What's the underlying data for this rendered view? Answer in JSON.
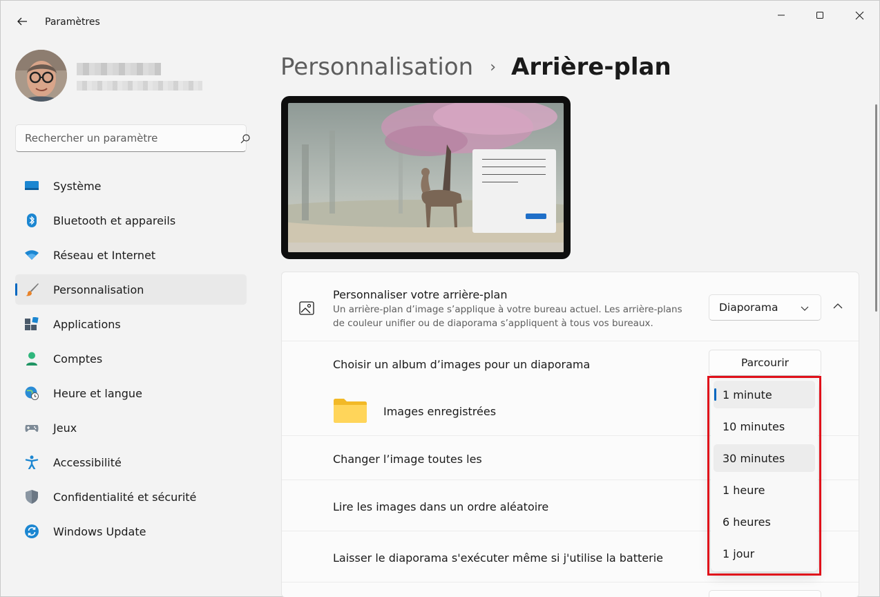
{
  "window": {
    "title": "Paramètres"
  },
  "search": {
    "placeholder": "Rechercher un paramètre"
  },
  "sidebar": {
    "items": [
      {
        "label": "Système",
        "icon": "monitor-icon"
      },
      {
        "label": "Bluetooth et appareils",
        "icon": "bluetooth-icon"
      },
      {
        "label": "Réseau et Internet",
        "icon": "wifi-icon"
      },
      {
        "label": "Personnalisation",
        "icon": "brush-icon",
        "active": true
      },
      {
        "label": "Applications",
        "icon": "apps-icon"
      },
      {
        "label": "Comptes",
        "icon": "person-icon"
      },
      {
        "label": "Heure et langue",
        "icon": "globe-clock-icon"
      },
      {
        "label": "Jeux",
        "icon": "gamepad-icon"
      },
      {
        "label": "Accessibilité",
        "icon": "accessibility-icon"
      },
      {
        "label": "Confidentialité et sécurité",
        "icon": "shield-icon"
      },
      {
        "label": "Windows Update",
        "icon": "update-icon"
      }
    ]
  },
  "breadcrumb": {
    "parent": "Personnalisation",
    "separator": "›",
    "current": "Arrière-plan"
  },
  "background_card": {
    "title": "Personnaliser votre arrière-plan",
    "description": "Un arrière-plan d’image s’applique à votre bureau actuel. Les arrière-plans de couleur unifier ou de diaporama s’appliquent à tous vos bureaux.",
    "select_value": "Diaporama"
  },
  "rows": {
    "album_label": "Choisir un album d’images pour un diaporama",
    "browse_label": "Parcourir",
    "folder_label": "Images enregistrées",
    "change_label": "Changer l’image toutes les",
    "shuffle_label": "Lire les images dans un ordre aléatoire",
    "battery_label": "Laisser le diaporama s'exécuter même si j'utilise la batterie"
  },
  "interval_dropdown": {
    "options": [
      "1 minute",
      "10 minutes",
      "30 minutes",
      "1 heure",
      "6 heures",
      "1 jour"
    ],
    "selected": "1 minute",
    "hovered": "30 minutes"
  },
  "colors": {
    "accent": "#0067c0",
    "highlight": "#e0101a"
  }
}
